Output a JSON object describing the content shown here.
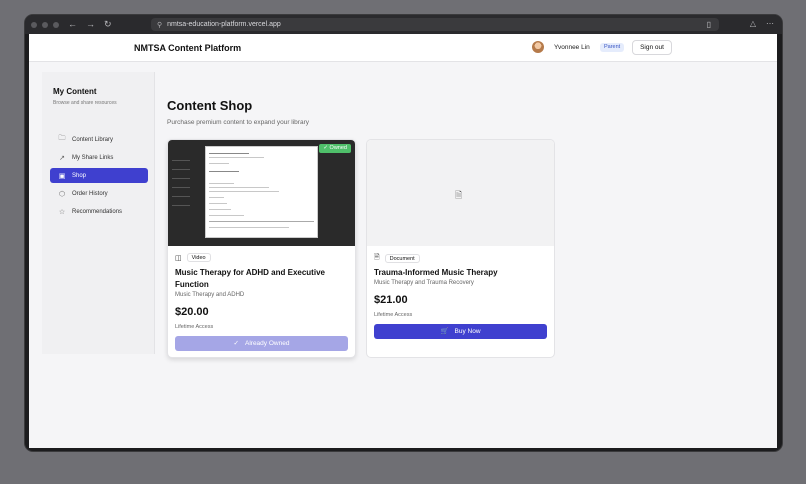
{
  "browser": {
    "url": "nmtsa-education-platform.vercel.app",
    "nav_back": "←",
    "nav_forward": "→",
    "nav_reload": "↻"
  },
  "header": {
    "brand": "NMTSA Content Platform",
    "user_name": "Yvonnee Lin",
    "role_badge": "Parent",
    "sign_out": "Sign out"
  },
  "sidebar": {
    "title": "My Content",
    "subtitle": "Browse and share resources",
    "items": [
      {
        "label": "Content Library",
        "icon": "folder-icon",
        "active": false
      },
      {
        "label": "My Share Links",
        "icon": "external-link-icon",
        "active": false
      },
      {
        "label": "Shop",
        "icon": "shopping-bag-icon",
        "active": true
      },
      {
        "label": "Order History",
        "icon": "package-icon",
        "active": false
      },
      {
        "label": "Recommendations",
        "icon": "star-icon",
        "active": false
      }
    ]
  },
  "main": {
    "title": "Content Shop",
    "subtitle": "Purchase premium content to expand your library"
  },
  "products": [
    {
      "type": "Video",
      "type_icon": "video-icon",
      "title": "Music Therapy for ADHD and Executive Function",
      "category": "Music Therapy and ADHD",
      "price": "$20.00",
      "access": "Lifetime Access",
      "owned_badge": "✓ Owned",
      "button_label": "Already Owned",
      "button_state": "disabled"
    },
    {
      "type": "Document",
      "type_icon": "document-icon",
      "title": "Trauma-Informed Music Therapy",
      "category": "Music Therapy and Trauma Recovery",
      "price": "$21.00",
      "access": "Lifetime Access",
      "button_label": "Buy Now",
      "button_state": "enabled"
    }
  ],
  "colors": {
    "accent": "#3f40cf",
    "owned_green": "#4fbf6a",
    "disabled_button": "#a5a6e6"
  }
}
